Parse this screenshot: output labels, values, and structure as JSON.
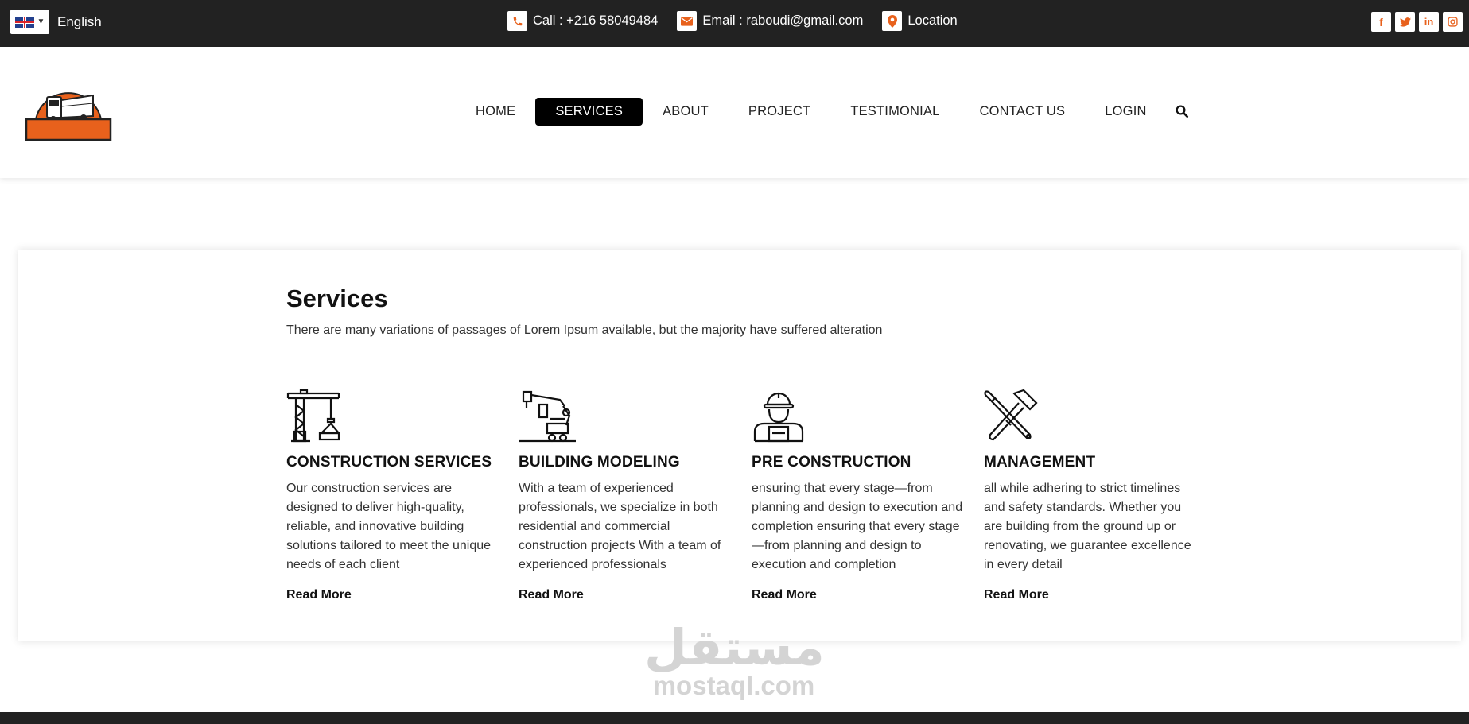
{
  "topbar": {
    "language": "English",
    "phone": "Call : +216 58049484",
    "email": "Email : raboudi@gmail.com",
    "location": "Location",
    "social_icons": [
      "facebook-icon",
      "twitter-icon",
      "linkedin-icon",
      "instagram-icon"
    ]
  },
  "nav": {
    "items": [
      "HOME",
      "SERVICES",
      "ABOUT",
      "PROJECT",
      "TESTIMONIAL",
      "CONTACT US",
      "LOGIN"
    ],
    "active": "SERVICES"
  },
  "section": {
    "title": "Services",
    "subtitle": "There are many variations of passages of Lorem Ipsum available, but the majority have suffered alteration"
  },
  "services": [
    {
      "icon": "crane-icon",
      "title": "CONSTRUCTION SERVICES",
      "description": "Our construction services are designed to deliver high-quality, reliable, and innovative building solutions tailored to meet the unique needs of each client",
      "link": "Read More"
    },
    {
      "icon": "robotic-arm-icon",
      "title": "BUILDING MODELING",
      "description": "With a team of experienced professionals, we specialize in both residential and commercial construction projects With a team of experienced professionals",
      "link": "Read More"
    },
    {
      "icon": "worker-icon",
      "title": "PRE CONSTRUCTION",
      "description": "ensuring that every stage—from planning and design to execution and completion ensuring that every stage—from planning and design to execution and completion",
      "link": "Read More"
    },
    {
      "icon": "hammer-wrench-icon",
      "title": "MANAGEMENT",
      "description": "all while adhering to strict timelines and safety standards. Whether you are building from the ground up or renovating, we guarantee excellence in every detail",
      "link": "Read More"
    }
  ],
  "watermark": {
    "arabic": "مستقل",
    "latin": "mostaql.com"
  },
  "colors": {
    "accent": "#e8611c",
    "topbar": "#222222",
    "active_nav": "#000000"
  }
}
